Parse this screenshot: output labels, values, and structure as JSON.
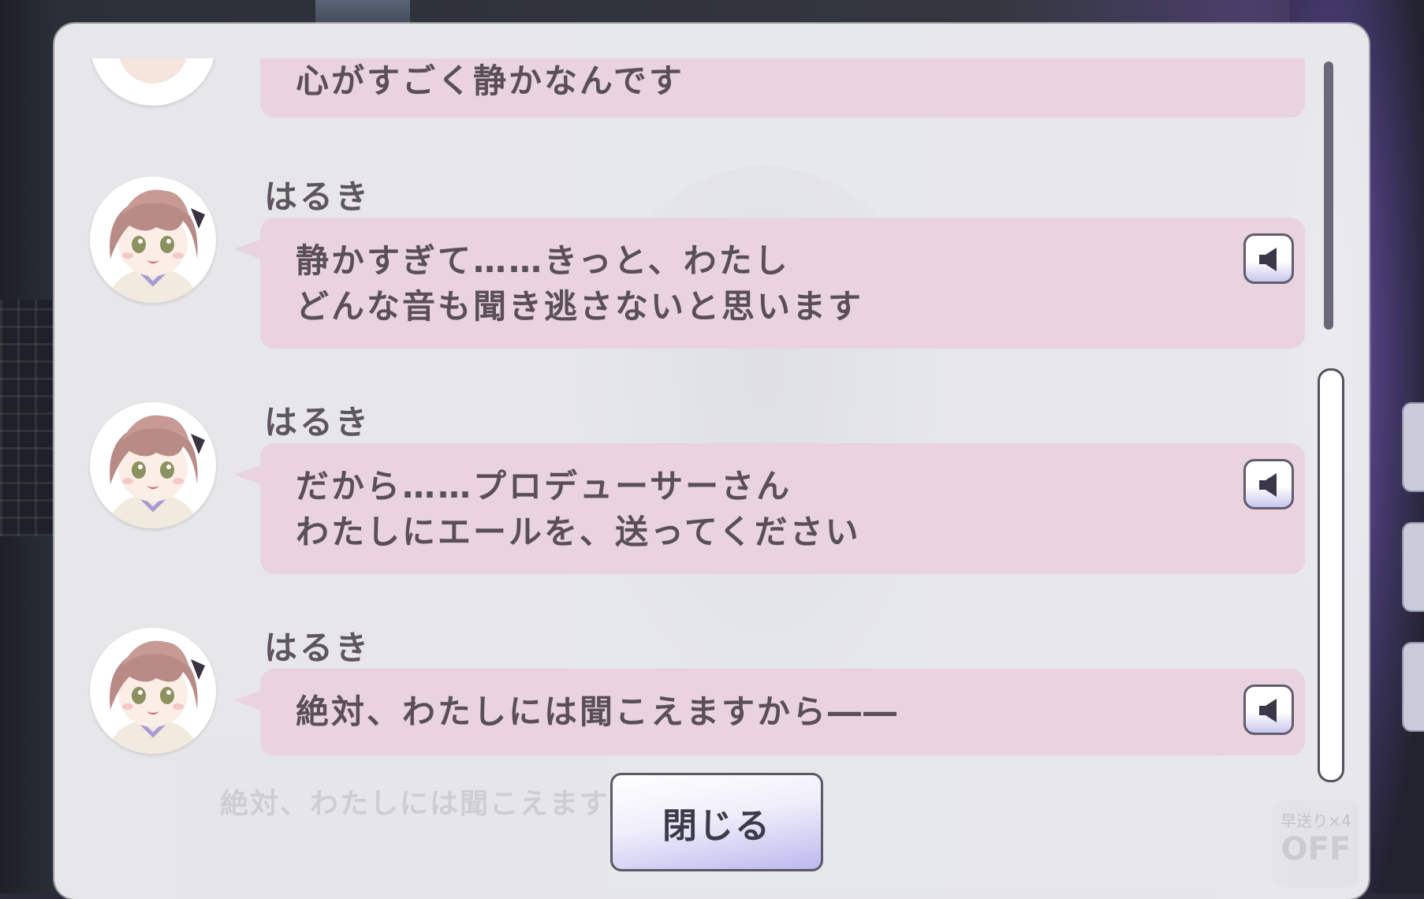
{
  "log": {
    "entries": [
      {
        "speaker": "",
        "lines": [
          "心がすごく静かなんです"
        ],
        "voice_icon": "speaker-icon",
        "has_voice": false
      },
      {
        "speaker": "はるき",
        "lines": [
          "静かすぎて……きっと、わたし",
          "どんな音も聞き逃さないと思います"
        ],
        "voice_icon": "speaker-icon",
        "has_voice": true
      },
      {
        "speaker": "はるき",
        "lines": [
          "だから……プロデューサーさん",
          "わたしにエールを、送ってください"
        ],
        "voice_icon": "speaker-icon",
        "has_voice": true
      },
      {
        "speaker": "はるき",
        "lines": [
          "絶対、わたしには聞こえますから――"
        ],
        "voice_icon": "speaker-icon",
        "has_voice": true
      }
    ]
  },
  "close_button": {
    "label": "閉じる"
  },
  "background": {
    "ghost_text": "絶対、わたしには聞こえますから",
    "fast_forward_label": "早送り×4",
    "fast_forward_value": "OFF"
  },
  "colors": {
    "bubble": "#e8d3de",
    "panel": "#eeeef0",
    "text": "#5a4f59",
    "button_accent": "#bdb8ee"
  }
}
